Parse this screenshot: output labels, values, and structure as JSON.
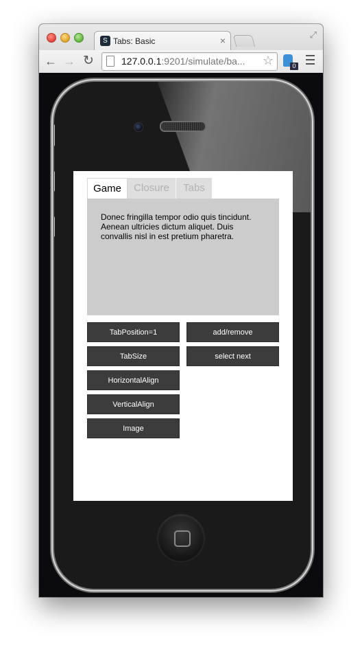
{
  "browser": {
    "tab_title": "Tabs: Basic",
    "favicon_glyph": "S",
    "close_glyph": "×",
    "url_host": "127.0.0.1",
    "url_rest": ":9201/simulate/ba...",
    "extension_badge": "0"
  },
  "app": {
    "tabs": [
      {
        "label": "Game",
        "selected": true
      },
      {
        "label": "Closure",
        "selected": false
      },
      {
        "label": "Tabs",
        "selected": false
      }
    ],
    "content_text": "Donec fringilla tempor odio quis tincidunt. Aenean ultricies dictum aliquet. Duis convallis nisl in est pretium pharetra.",
    "buttons_left": [
      "TabPosition=1",
      "TabSize",
      "HorizontalAlign",
      "VerticalAlign",
      "Image"
    ],
    "buttons_right": [
      "add/remove",
      "select next"
    ]
  },
  "colors": {
    "panel_bg": "#cccccc",
    "button_bg": "#3c3c3c",
    "inactive_tab_text": "#b2b2b2"
  }
}
